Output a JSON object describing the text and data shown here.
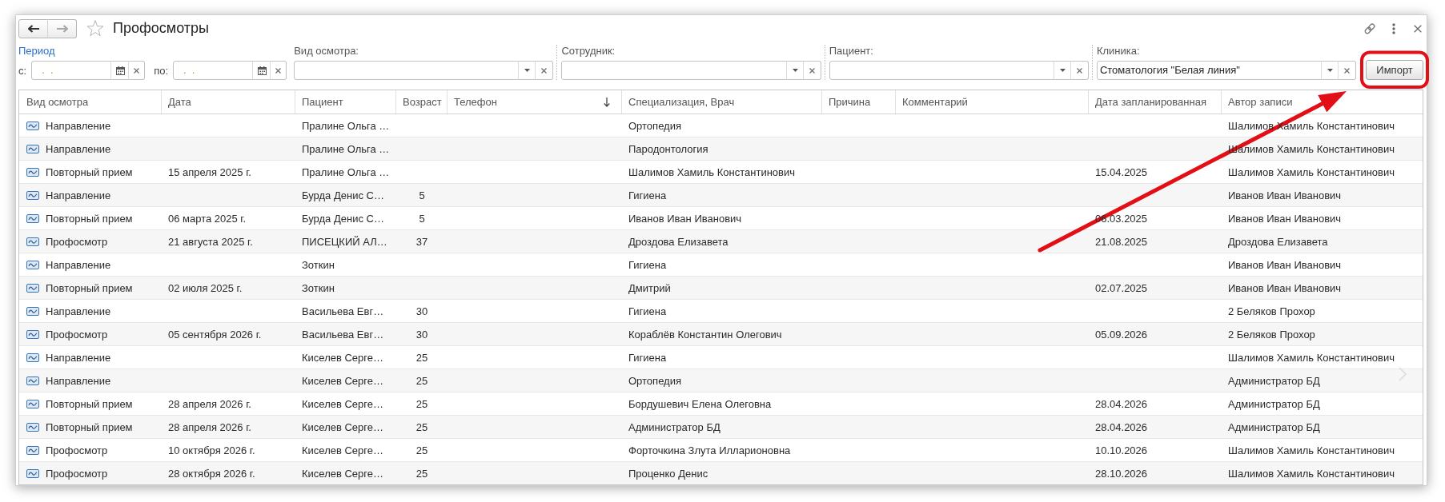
{
  "window": {
    "title": "Профосмотры",
    "starred": false,
    "nav": [
      {
        "kind": "back",
        "disabled": false
      },
      {
        "kind": "forward",
        "disabled": true
      }
    ]
  },
  "filters": {
    "period": {
      "label": "Период",
      "from": {
        "label": "с:",
        "value": ".  ."
      },
      "to": {
        "label": "по:",
        "value": ".  ."
      }
    },
    "fields": [
      {
        "label": "Вид осмотра:"
      },
      {
        "label": "Сотрудник:"
      },
      {
        "label": "Пациент:"
      },
      {
        "label": "Клиника:",
        "value": "Стоматология \"Белая линия\""
      }
    ],
    "import_button": "Импорт"
  },
  "table": {
    "columns": [
      {
        "label": "Вид осмотра",
        "sorted": false
      },
      {
        "label": "Дата",
        "sorted": false
      },
      {
        "label": "Пациент",
        "sorted": false
      },
      {
        "label": "Возраст",
        "sorted": false
      },
      {
        "label": "Телефон",
        "sorted": true
      },
      {
        "label": "Специализация, Врач",
        "sorted": false
      },
      {
        "label": "Причина",
        "sorted": false
      },
      {
        "label": "Комментарий",
        "sorted": false
      },
      {
        "label": "Дата запланированная",
        "sorted": false
      },
      {
        "label": "Автор записи",
        "sorted": false
      }
    ],
    "rows": [
      {
        "type": "Направление",
        "patient": "Пралине Ольга …",
        "specialist": "Ортопедия",
        "author": "Шалимов Хамиль Константинович"
      },
      {
        "type": "Направление",
        "patient": "Пралине Ольга …",
        "specialist": "Пародонтология",
        "author": "Шалимов Хамиль Константинович"
      },
      {
        "type": "Повторный прием",
        "date": "15 апреля 2025 г.",
        "patient": "Пралине Ольга …",
        "specialist": "Шалимов Хамиль Константинович",
        "planned": "15.04.2025",
        "author": "Шалимов Хамиль Константинович"
      },
      {
        "type": "Направление",
        "patient": "Бурда Денис С…",
        "age": "5",
        "specialist": "Гигиена",
        "author": "Иванов Иван Иванович"
      },
      {
        "type": "Повторный прием",
        "date": "06 марта 2025 г.",
        "patient": "Бурда Денис С…",
        "age": "5",
        "specialist": "Иванов Иван Иванович",
        "planned": "06.03.2025",
        "author": "Иванов Иван Иванович"
      },
      {
        "type": "Профосмотр",
        "date": "21 августа 2025 г.",
        "patient": "ПИСЕЦКИЙ АЛ…",
        "age": "37",
        "specialist": "Дроздова Елизавета",
        "planned": "21.08.2025",
        "author": "Дроздова Елизавета"
      },
      {
        "type": "Направление",
        "patient": "Зоткин",
        "specialist": "Гигиена",
        "author": "Иванов Иван Иванович"
      },
      {
        "type": "Повторный прием",
        "date": "02 июля 2025 г.",
        "patient": "Зоткин",
        "specialist": "Дмитрий",
        "planned": "02.07.2025",
        "author": "Иванов Иван Иванович"
      },
      {
        "type": "Направление",
        "patient": "Васильева Евг…",
        "age": "30",
        "specialist": "Гигиена",
        "author": "2 Беляков Прохор"
      },
      {
        "type": "Профосмотр",
        "date": "05 сентября 2026 г.",
        "patient": "Васильева Евг…",
        "age": "30",
        "specialist": "Кораблёв Константин Олегович",
        "planned": "05.09.2026",
        "author": "2 Беляков Прохор"
      },
      {
        "type": "Направление",
        "patient": "Киселев Серге…",
        "age": "25",
        "specialist": "Гигиена",
        "author": "Шалимов Хамиль Константинович"
      },
      {
        "type": "Направление",
        "patient": "Киселев Серге…",
        "age": "25",
        "specialist": "Ортопедия",
        "author": "Администратор БД"
      },
      {
        "type": "Повторный прием",
        "date": "28 апреля 2026 г.",
        "patient": "Киселев Серге…",
        "age": "25",
        "specialist": "Бордушевич Елена Олеговна",
        "planned": "28.04.2026",
        "author": "Администратор БД"
      },
      {
        "type": "Повторный прием",
        "date": "28 апреля 2026 г.",
        "patient": "Киселев Серге…",
        "age": "25",
        "specialist": "Администратор БД",
        "planned": "28.04.2026",
        "author": "Администратор БД"
      },
      {
        "type": "Профосмотр",
        "date": "10 октября 2026 г.",
        "patient": "Киселев Серге…",
        "age": "25",
        "specialist": "Форточкина Злута Илларионовна",
        "planned": "10.10.2026",
        "author": "Шалимов Хамиль Константинович"
      },
      {
        "type": "Профосмотр",
        "date": "28 октября 2026 г.",
        "patient": "Киселев Серге…",
        "age": "25",
        "specialist": "Проценко Денис",
        "planned": "28.10.2026",
        "author": "Шалимов Хамиль Константинович"
      }
    ]
  }
}
